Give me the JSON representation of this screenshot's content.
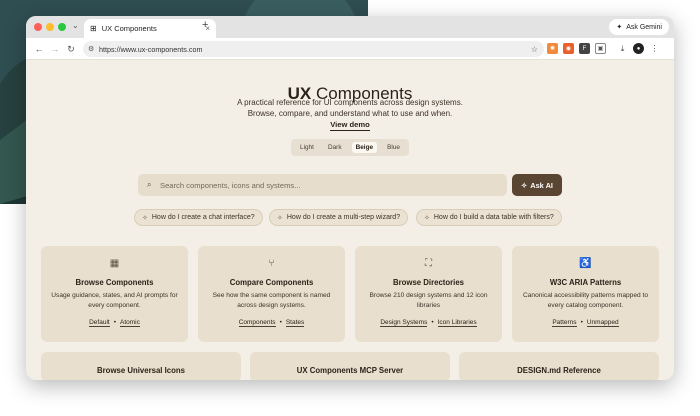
{
  "browser": {
    "tab_title": "UX Components",
    "new_tab": "+",
    "url": "https://www.ux-components.com",
    "ask_gemini": "Ask Gemini"
  },
  "hero": {
    "title_bold": "UX",
    "title_rest": " Components",
    "line1": "A practical reference for UI components across design systems.",
    "line2": "Browse, compare, and understand what to use and when.",
    "view_demo": "View demo"
  },
  "themes": [
    "Light",
    "Dark",
    "Beige",
    "Blue"
  ],
  "active_theme": "Beige",
  "search": {
    "placeholder": "Search components, icons and systems...",
    "ask_ai": "Ask AI"
  },
  "suggestions": [
    "How do I create a chat interface?",
    "How do I create a multi-step wizard?",
    "How do I build a data table with filters?"
  ],
  "cards": [
    {
      "title": "Browse Components",
      "desc": "Usage guidance, states, and AI prompts for every component.",
      "links": [
        "Default",
        "Atomic"
      ]
    },
    {
      "title": "Compare Components",
      "desc": "See how the same component is named across design systems.",
      "links": [
        "Components",
        "States"
      ]
    },
    {
      "title": "Browse Directories",
      "desc": "Browse 210 design systems and 12 icon libraries",
      "links": [
        "Design Systems",
        "Icon Libraries"
      ]
    },
    {
      "title": "W3C ARIA Patterns",
      "desc": "Canonical accessibility patterns mapped to every catalog component.",
      "links": [
        "Patterns",
        "Unmapped"
      ]
    }
  ],
  "cards_row2": [
    "Browse Universal Icons",
    "UX Components MCP Server",
    "DESIGN.md Reference"
  ],
  "colors": {
    "accent": "#5a4532",
    "page_bg": "#f4efe6",
    "card_bg": "#e9dfce"
  }
}
